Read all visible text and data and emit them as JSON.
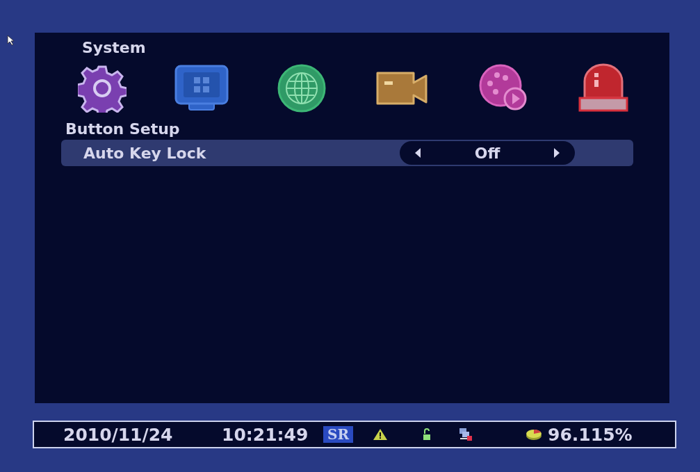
{
  "window": {
    "title": "System"
  },
  "categories": [
    {
      "kind": "gear"
    },
    {
      "kind": "monitor"
    },
    {
      "kind": "globe"
    },
    {
      "kind": "camera"
    },
    {
      "kind": "playback"
    },
    {
      "kind": "alarm"
    }
  ],
  "section": {
    "title": "Button Setup"
  },
  "settings": [
    {
      "label": "Auto Key Lock",
      "value": "Off"
    }
  ],
  "status_bar": {
    "date": "2010/11/24",
    "time": "10:21:49",
    "badge": "SR",
    "disk": "96.115%"
  }
}
